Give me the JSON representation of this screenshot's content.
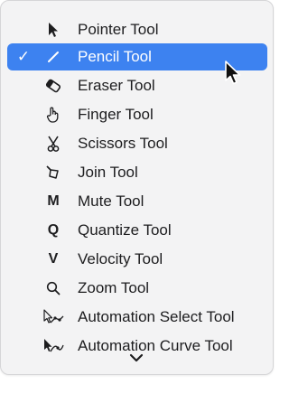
{
  "menu": {
    "items": [
      {
        "label": "Pointer Tool",
        "icon": "pointer-arrow-icon",
        "selected": false
      },
      {
        "label": "Pencil Tool",
        "icon": "pencil-icon",
        "selected": true,
        "check": "✓"
      },
      {
        "label": "Eraser Tool",
        "icon": "eraser-icon",
        "selected": false
      },
      {
        "label": "Finger Tool",
        "icon": "finger-hand-icon",
        "selected": false
      },
      {
        "label": "Scissors Tool",
        "icon": "scissors-icon",
        "selected": false
      },
      {
        "label": "Join Tool",
        "icon": "join-glue-icon",
        "selected": false
      },
      {
        "label": "Mute Tool",
        "icon": "M",
        "selected": false
      },
      {
        "label": "Quantize Tool",
        "icon": "Q",
        "selected": false
      },
      {
        "label": "Velocity Tool",
        "icon": "V",
        "selected": false
      },
      {
        "label": "Zoom Tool",
        "icon": "magnifier-icon",
        "selected": false
      },
      {
        "label": "Automation Select Tool",
        "icon": "automation-select-icon",
        "selected": false
      },
      {
        "label": "Automation Curve Tool",
        "icon": "automation-curve-icon",
        "selected": false
      }
    ],
    "scroll_indicator": "chevron-down-icon"
  },
  "colors": {
    "highlight": "#3d82f0",
    "menu_background": "#f3f3f4",
    "text": "#1d1d1f"
  }
}
